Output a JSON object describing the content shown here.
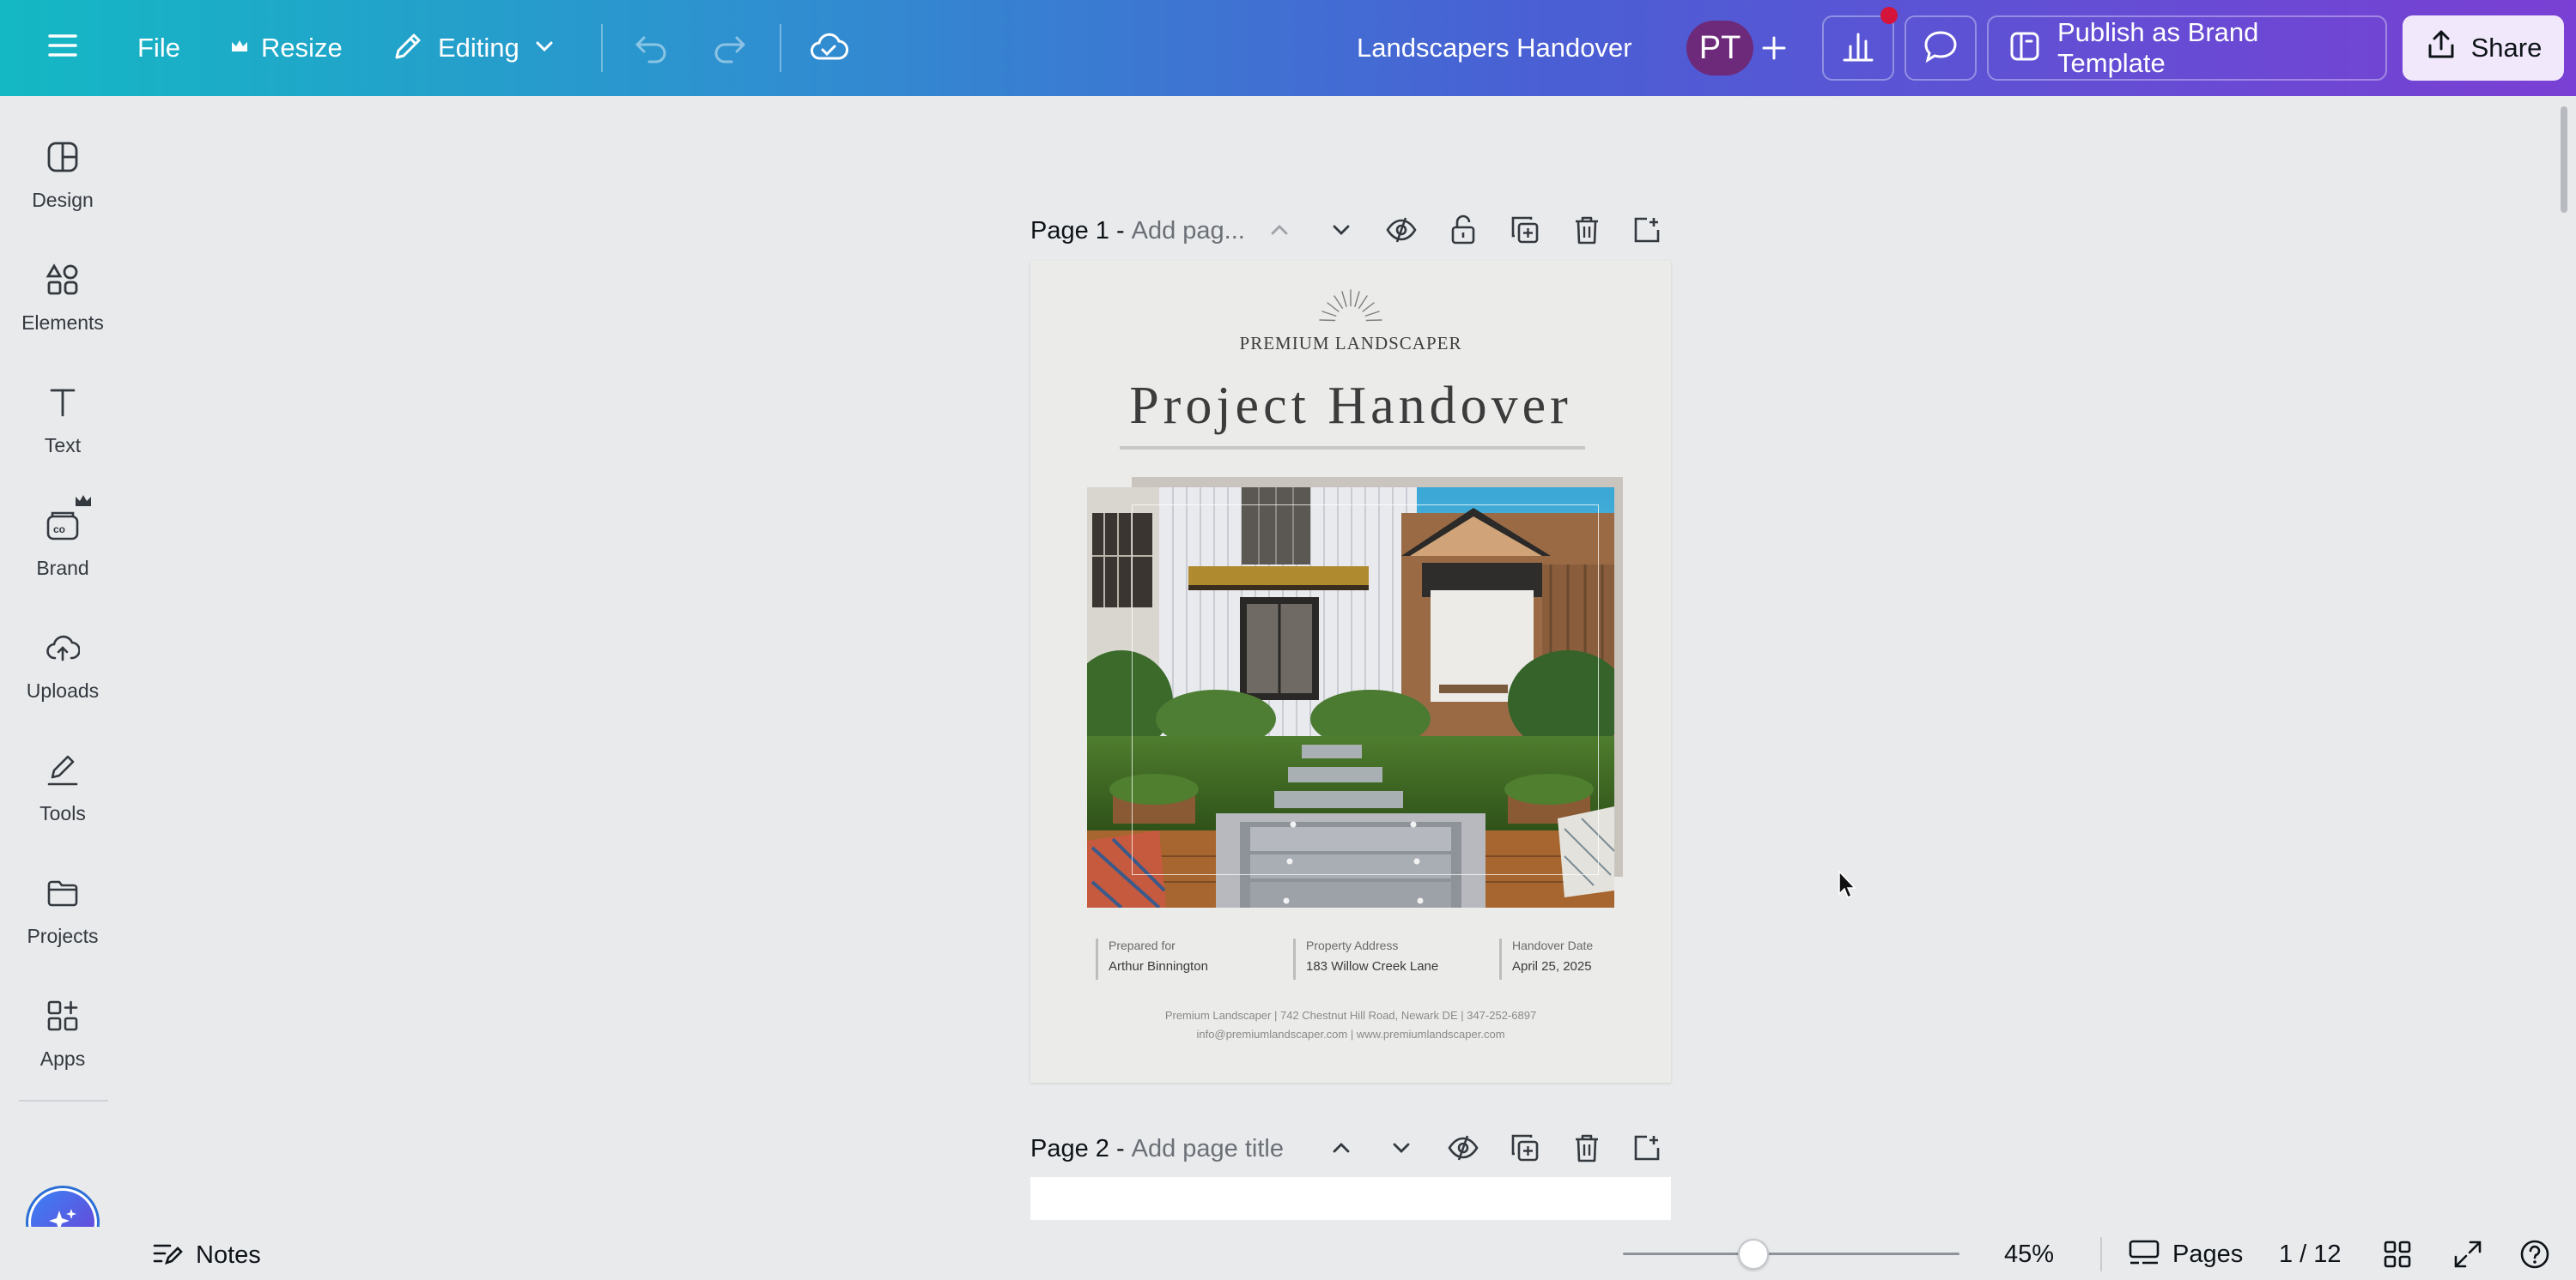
{
  "topbar": {
    "file_label": "File",
    "resize_label": "Resize",
    "editing_label": "Editing",
    "document_title": "Landscapers Handover",
    "avatar_initials": "PT",
    "publish_label": "Publish as Brand Template",
    "share_label": "Share"
  },
  "sidebar": {
    "items": [
      {
        "label": "Design",
        "icon": "design-icon"
      },
      {
        "label": "Elements",
        "icon": "elements-icon"
      },
      {
        "label": "Text",
        "icon": "text-icon"
      },
      {
        "label": "Brand",
        "icon": "brand-icon"
      },
      {
        "label": "Uploads",
        "icon": "uploads-icon"
      },
      {
        "label": "Tools",
        "icon": "tools-icon"
      },
      {
        "label": "Projects",
        "icon": "projects-icon"
      },
      {
        "label": "Apps",
        "icon": "apps-icon"
      }
    ]
  },
  "pages": [
    {
      "number_label": "Page 1 -",
      "title_placeholder": "Add pag..."
    },
    {
      "number_label": "Page 2 -",
      "title_placeholder": "Add page title"
    }
  ],
  "design": {
    "brand_name": "Premium Landscaper",
    "heading": "Project Handover",
    "prepared_for_label": "Prepared for",
    "prepared_for_value": "Arthur Binnington",
    "address_label": "Property Address",
    "address_value": "183 Willow Creek Lane",
    "date_label": "Handover Date",
    "date_value": "April 25, 2025",
    "footer_line1": "Premium Landscaper  |  742 Chestnut Hill Road, Newark DE  |  347-252-6897",
    "footer_line2": "info@premiumlandscaper.com  |  www.premiumlandscaper.com"
  },
  "bottombar": {
    "notes_label": "Notes",
    "zoom_level": "45%",
    "zoom_fraction": 0.45,
    "pages_label": "Pages",
    "page_counter": "1 / 12"
  },
  "colors": {
    "gradient_start": "#14b8c4",
    "gradient_end": "#7a3fd4",
    "avatar_bg": "#6d2a7a",
    "notification_dot": "#d4143a"
  }
}
